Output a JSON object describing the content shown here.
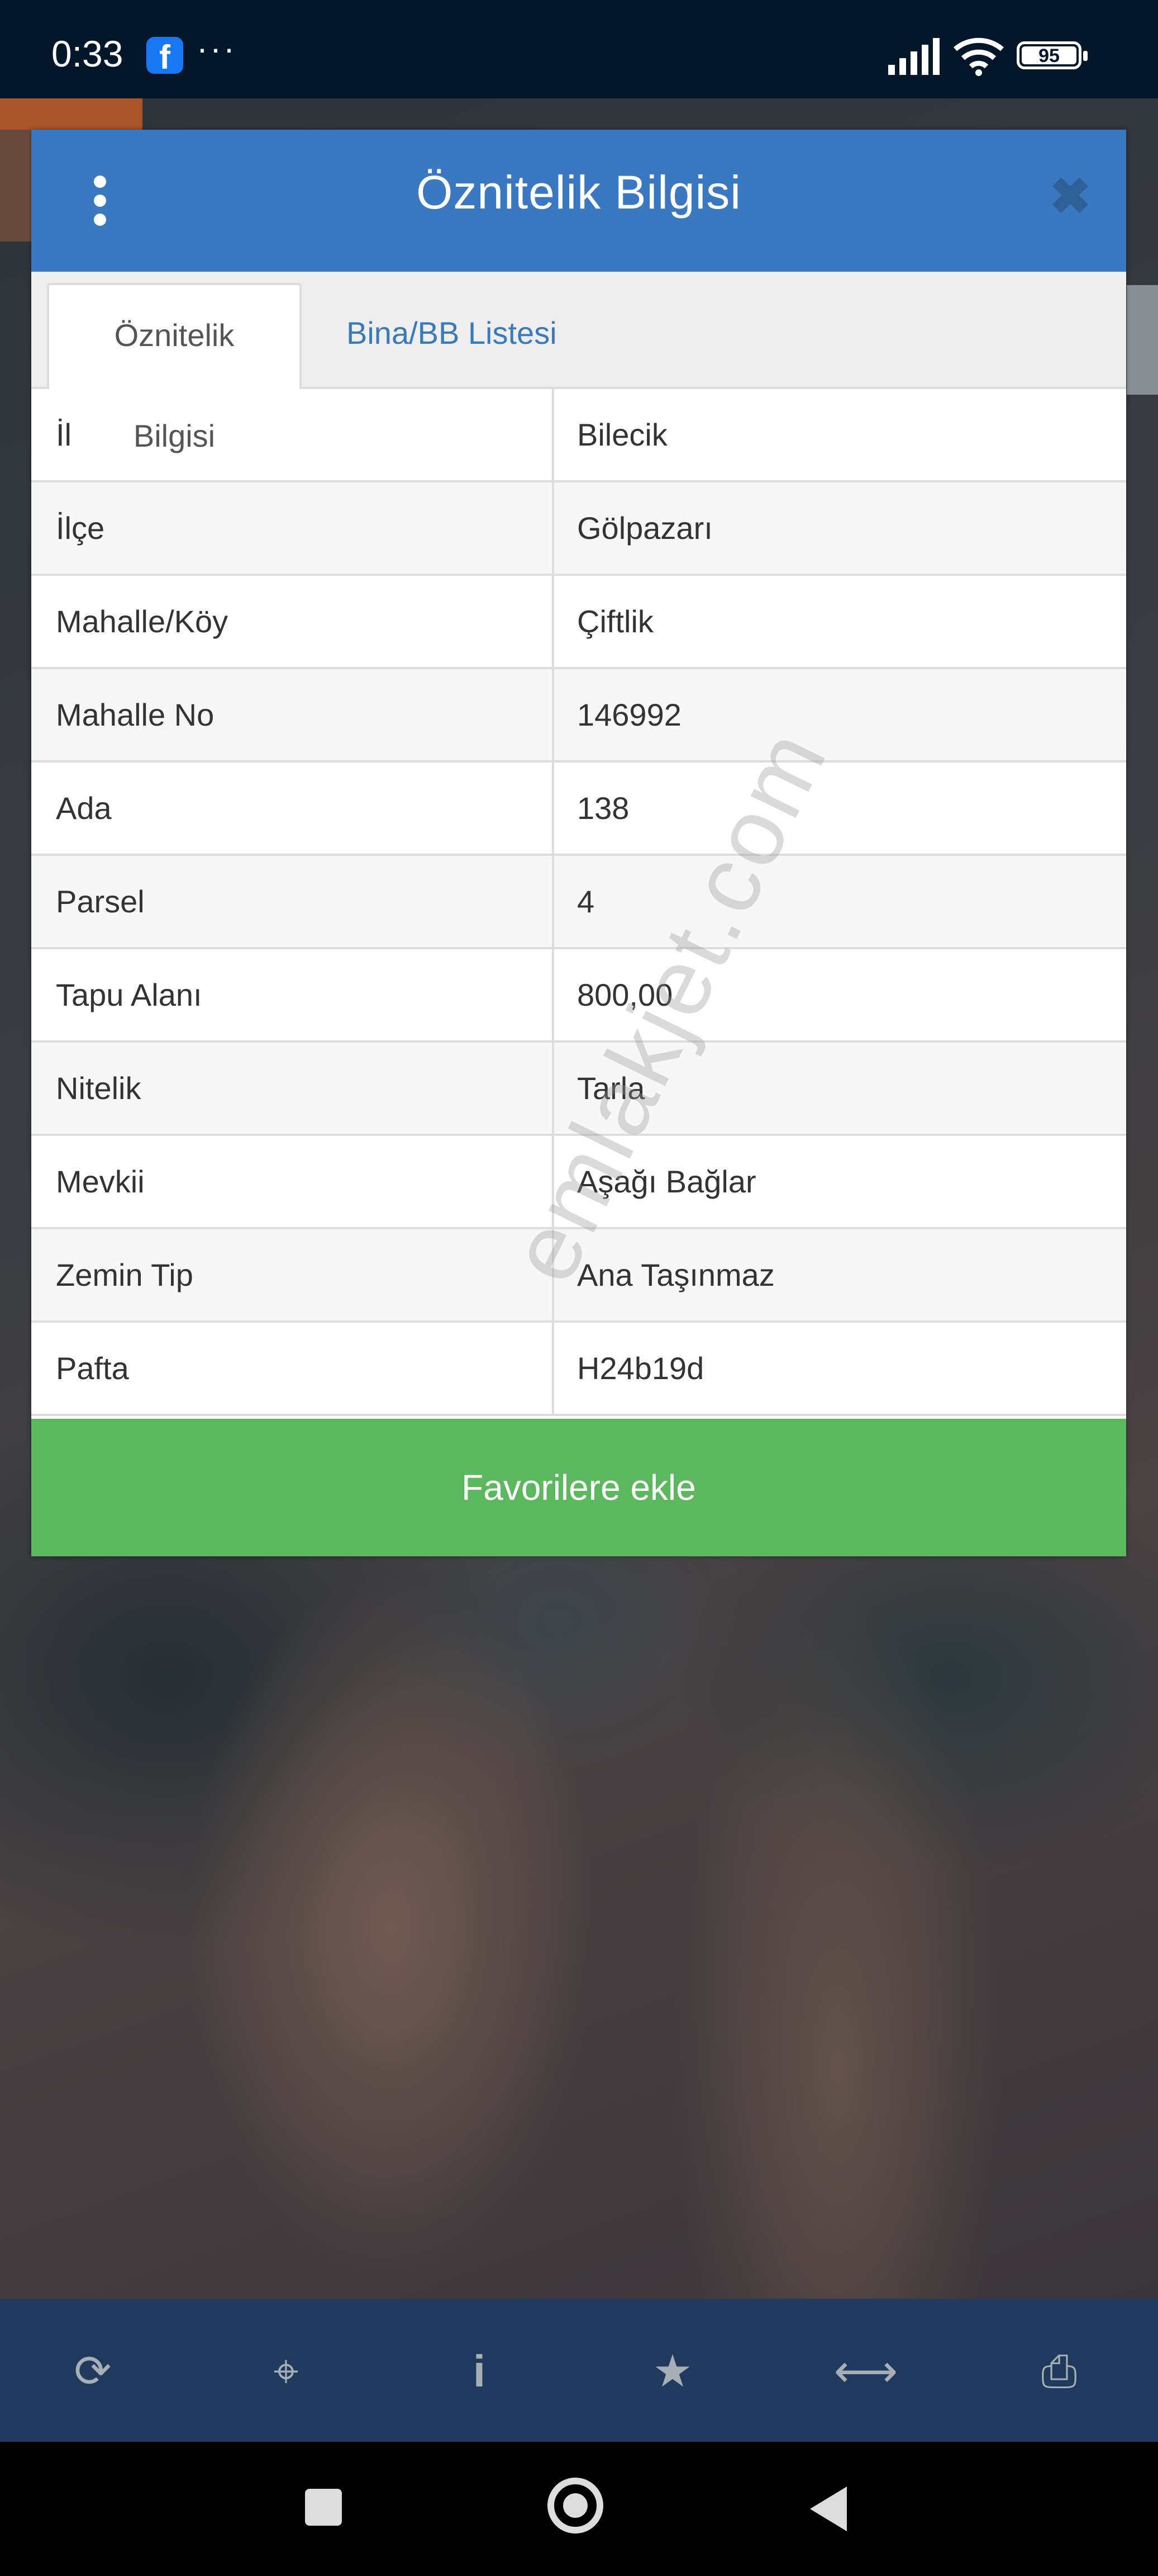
{
  "status_bar": {
    "time": "0:33",
    "notification_icons": [
      "facebook-icon",
      "more-dots-icon"
    ],
    "battery": "95",
    "system_icons": [
      "signal-icon",
      "wifi-icon",
      "battery-icon"
    ]
  },
  "dialog": {
    "title": "Öznitelik Bilgisi",
    "menu_icon": "kebab-menu-icon",
    "close_icon": "close-icon",
    "tabs": [
      {
        "label": "Öznitelik Bilgisi",
        "active": true
      },
      {
        "label": "Bina/BB Listesi",
        "active": false
      }
    ],
    "rows": [
      {
        "label": "İl",
        "value": "Bilecik"
      },
      {
        "label": "İlçe",
        "value": "Gölpazarı"
      },
      {
        "label": "Mahalle/Köy",
        "value": "Çiftlik"
      },
      {
        "label": "Mahalle No",
        "value": "146992"
      },
      {
        "label": "Ada",
        "value": "138"
      },
      {
        "label": "Parsel",
        "value": "4"
      },
      {
        "label": "Tapu Alanı",
        "value": "800,00"
      },
      {
        "label": "Nitelik",
        "value": "Tarla"
      },
      {
        "label": "Mevkii",
        "value": "Aşağı Bağlar"
      },
      {
        "label": "Zemin Tip",
        "value": "Ana Taşınmaz"
      },
      {
        "label": "Pafta",
        "value": "H24b19d"
      }
    ],
    "favorite_button": "Favorilere ekle",
    "accent_color": "#3a79c2",
    "button_color": "#5cb85c"
  },
  "watermark": "emlakjet.com",
  "toolbar": {
    "icons": [
      "refresh-icon",
      "crosshair-icon",
      "info-icon",
      "star-icon",
      "arrows-horizontal-icon",
      "print-icon"
    ],
    "glyphs": [
      "⟳",
      "⌖",
      "i",
      "★",
      "⟷",
      "⎙"
    ]
  },
  "nav_bar": {
    "icons": [
      "recents-icon",
      "home-icon",
      "back-icon"
    ]
  }
}
